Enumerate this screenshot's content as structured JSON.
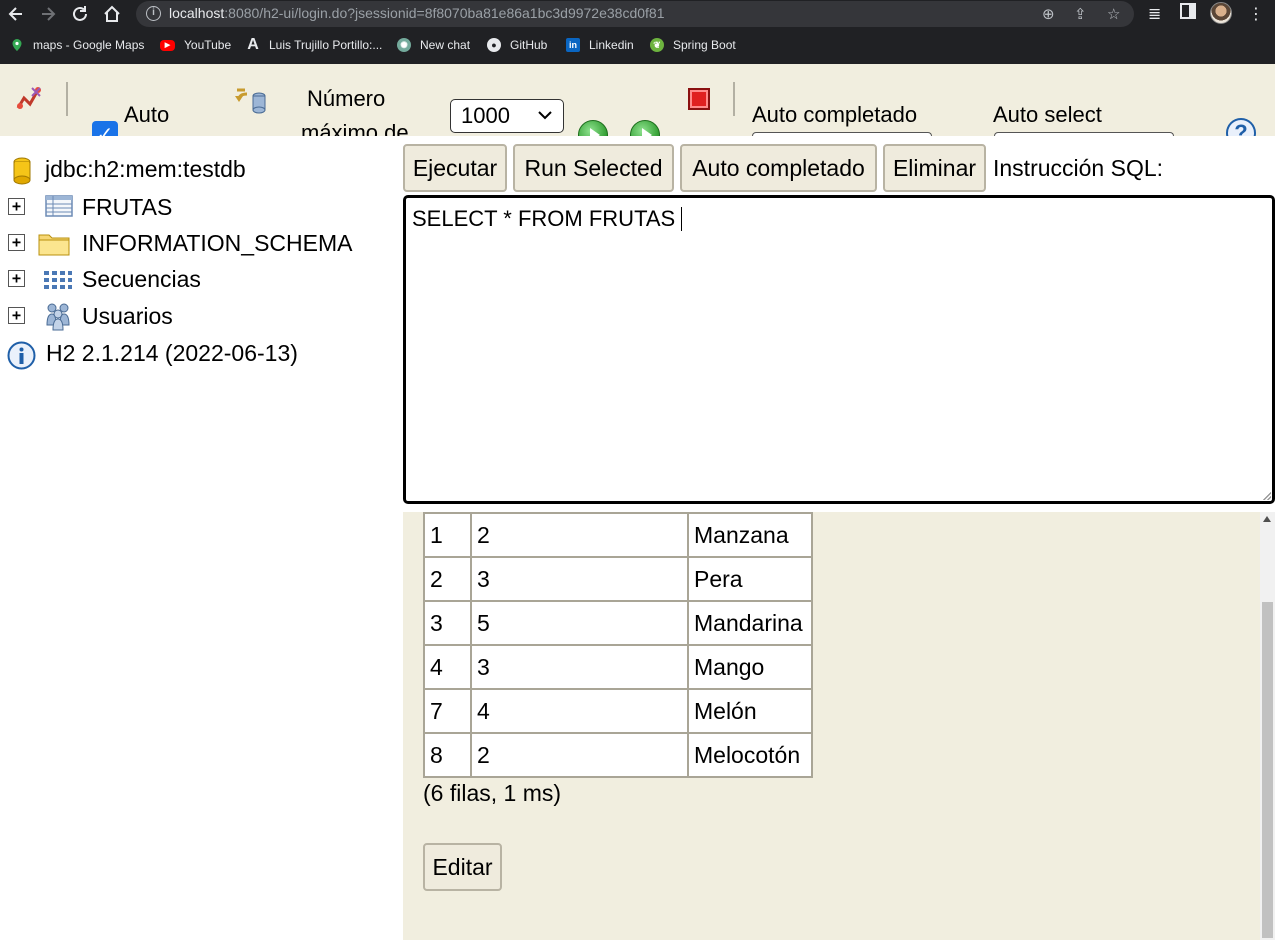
{
  "browser": {
    "url_host": "localhost",
    "url_rest": ":8080/h2-ui/login.do?jsessionid=8f8070ba81e86a1bc3d9972e38cd0f81",
    "bookmarks": [
      {
        "label": "maps - Google Maps",
        "icon": "map-pin-icon",
        "color": "#34a853"
      },
      {
        "label": "YouTube",
        "icon": "youtube-icon",
        "color": "#ff0000"
      },
      {
        "label": "Luis Trujillo Portillo:...",
        "icon": "a-logo-icon",
        "color": "#202124"
      },
      {
        "label": "New chat",
        "icon": "openai-icon",
        "color": "#74aa9c"
      },
      {
        "label": "GitHub",
        "icon": "github-icon",
        "color": "#ffffff"
      },
      {
        "label": "Linkedin",
        "icon": "linkedin-icon",
        "color": "#0a66c2"
      },
      {
        "label": "Spring Boot",
        "icon": "spring-icon",
        "color": "#6db33f"
      }
    ]
  },
  "toolbar": {
    "auto_label": "Auto",
    "max_rows_label_line1": "Número",
    "max_rows_label_line2": "máximo de",
    "max_rows_value": "1000",
    "autocomplete_label": "Auto completado",
    "autoselect_label": "Auto select"
  },
  "tree": {
    "connection": "jdbc:h2:mem:testdb",
    "nodes": [
      {
        "label": "FRUTAS",
        "icon": "table-icon"
      },
      {
        "label": "INFORMATION_SCHEMA",
        "icon": "folder-icon"
      },
      {
        "label": "Secuencias",
        "icon": "sequence-icon"
      },
      {
        "label": "Usuarios",
        "icon": "users-icon"
      }
    ],
    "version": "H2 2.1.214 (2022-06-13)"
  },
  "actions": {
    "execute": "Ejecutar",
    "run_selected": "Run Selected",
    "autocomplete": "Auto completado",
    "delete": "Eliminar",
    "sql_label": "Instrucción SQL:"
  },
  "editor": {
    "sql": "SELECT * FROM FRUTAS"
  },
  "results": {
    "rows": [
      [
        "1",
        "2",
        "Manzana"
      ],
      [
        "2",
        "3",
        "Pera"
      ],
      [
        "3",
        "5",
        "Mandarina"
      ],
      [
        "4",
        "3",
        "Mango"
      ],
      [
        "7",
        "4",
        "Melón"
      ],
      [
        "8",
        "2",
        "Melocotón"
      ]
    ],
    "summary": "(6 filas, 1 ms)",
    "edit_button": "Editar"
  },
  "colors": {
    "panel_bg": "#f1eedf",
    "chrome_bg": "#202124",
    "checkbox": "#1a73e8"
  }
}
